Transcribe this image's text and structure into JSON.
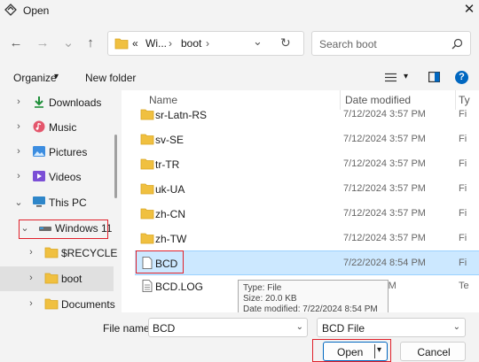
{
  "window": {
    "title": "Open",
    "close_glyph": "✕"
  },
  "nav_buttons": {
    "back": "←",
    "forward": "→",
    "up": "↑"
  },
  "address": {
    "overflow": "«",
    "segments": [
      "Wi...",
      "boot"
    ],
    "separator": "›",
    "dropdown": "⌄",
    "refresh": "↻"
  },
  "search": {
    "placeholder": "Search boot"
  },
  "toolbar": {
    "organize_label": "Organize",
    "organize_caret": "▾",
    "new_folder_label": "New folder",
    "view_caret": "▾",
    "help": "?"
  },
  "nav_pane": {
    "items": [
      {
        "label": "Downloads",
        "chevron": "›",
        "icon": "download-icon"
      },
      {
        "label": "Music",
        "chevron": "›",
        "icon": "music-icon"
      },
      {
        "label": "Pictures",
        "chevron": "›",
        "icon": "pictures-icon"
      },
      {
        "label": "Videos",
        "chevron": "›",
        "icon": "videos-icon"
      },
      {
        "label": "This PC",
        "chevron": "⌄",
        "icon": "computer-icon"
      },
      {
        "label": "Windows 11",
        "chevron": "⌄",
        "icon": "drive-icon"
      },
      {
        "label": "$RECYCLE.BIN",
        "chevron": "›",
        "icon": "folder-icon"
      },
      {
        "label": "boot",
        "chevron": "›",
        "icon": "folder-icon"
      },
      {
        "label": "Documents",
        "chevron": "›",
        "icon": "folder-icon"
      }
    ]
  },
  "columns": {
    "name": "Name",
    "date": "Date modified",
    "type": "Ty"
  },
  "files": [
    {
      "name": "sr-Latn-RS",
      "date": "7/12/2024 3:57 PM",
      "type": "Fi",
      "kind": "folder"
    },
    {
      "name": "sv-SE",
      "date": "7/12/2024 3:57 PM",
      "type": "Fi",
      "kind": "folder"
    },
    {
      "name": "tr-TR",
      "date": "7/12/2024 3:57 PM",
      "type": "Fi",
      "kind": "folder"
    },
    {
      "name": "uk-UA",
      "date": "7/12/2024 3:57 PM",
      "type": "Fi",
      "kind": "folder"
    },
    {
      "name": "zh-CN",
      "date": "7/12/2024 3:57 PM",
      "type": "Fi",
      "kind": "folder"
    },
    {
      "name": "zh-TW",
      "date": "7/12/2024 3:57 PM",
      "type": "Fi",
      "kind": "folder"
    },
    {
      "name": "BCD",
      "date": "7/22/2024 8:54 PM",
      "type": "Fi",
      "kind": "file"
    },
    {
      "name": "BCD.LOG",
      "date": "29 PM",
      "type": "Te",
      "kind": "file"
    }
  ],
  "tooltip": {
    "type_line": "Type: File",
    "size_line": "Size: 20.0 KB",
    "date_line": "Date modified: 7/22/2024 8:54 PM"
  },
  "footer": {
    "file_name_label": "File name:",
    "file_name_value": "BCD",
    "file_type_value": "BCD File",
    "dropdown": "⌄",
    "open_label": "Open",
    "open_caret": "▾",
    "cancel_label": "Cancel"
  },
  "colors": {
    "accent": "#0067c0",
    "selection": "#cce8ff",
    "highlight_box": "#e0202a",
    "folder": "#f0c040"
  }
}
